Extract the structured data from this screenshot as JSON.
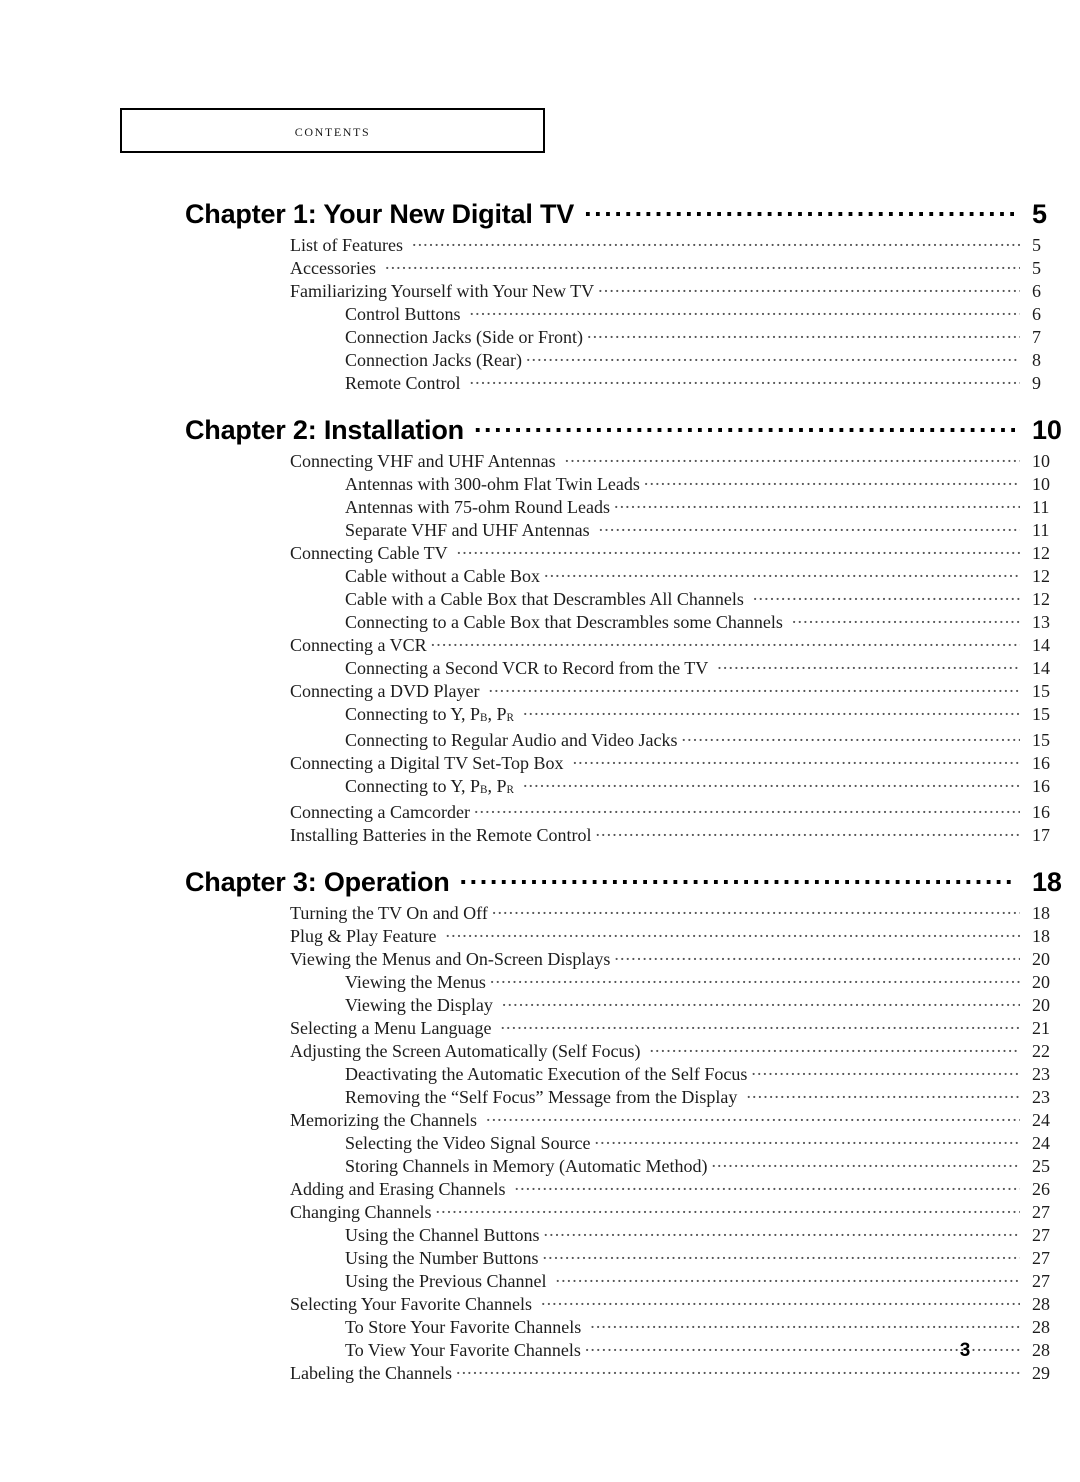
{
  "header": {
    "label": "Contents"
  },
  "folio": {
    "page_number": "3"
  },
  "toc": {
    "chapters": [
      {
        "title": "Chapter 1: Your New Digital TV",
        "page": "5",
        "entries": [
          {
            "level": 1,
            "text": "List of Features",
            "page": "5",
            "gap": true
          },
          {
            "level": 1,
            "text": "Accessories",
            "page": "5",
            "gap": true
          },
          {
            "level": 1,
            "text": "Familiarizing Yourself with Your New TV",
            "page": "6",
            "gap": false
          },
          {
            "level": 2,
            "text": "Control Buttons",
            "page": "6",
            "gap": true
          },
          {
            "level": 2,
            "text": "Connection Jacks (Side or Front)",
            "page": "7",
            "gap": false
          },
          {
            "level": 2,
            "text": "Connection Jacks (Rear)",
            "page": "8",
            "gap": false
          },
          {
            "level": 2,
            "text": "Remote Control",
            "page": "9",
            "gap": true
          }
        ]
      },
      {
        "title": "Chapter 2: Installation",
        "page": "10",
        "entries": [
          {
            "level": 1,
            "text": "Connecting VHF and UHF Antennas",
            "page": "10",
            "gap": true
          },
          {
            "level": 2,
            "text": "Antennas with 300-ohm Flat Twin Leads",
            "page": "10",
            "gap": false
          },
          {
            "level": 2,
            "text": "Antennas with 75-ohm Round Leads",
            "page": "11",
            "gap": false
          },
          {
            "level": 2,
            "text": "Separate VHF and UHF Antennas",
            "page": "11",
            "gap": true
          },
          {
            "level": 1,
            "text": "Connecting Cable TV",
            "page": "12",
            "gap": true
          },
          {
            "level": 2,
            "text": "Cable without a Cable Box",
            "page": "12",
            "gap": false
          },
          {
            "level": 2,
            "text": "Cable with a Cable Box that Descrambles All Channels",
            "page": "12",
            "gap": true
          },
          {
            "level": 2,
            "text": "Connecting to a Cable Box that Descrambles some Channels",
            "page": "13",
            "gap": true
          },
          {
            "level": 1,
            "text": "Connecting a VCR",
            "page": "14",
            "gap": false
          },
          {
            "level": 2,
            "text": "Connecting a Second VCR to Record from the TV",
            "page": "14",
            "gap": true
          },
          {
            "level": 1,
            "text": "Connecting a DVD Player",
            "page": "15",
            "gap": true
          },
          {
            "level": 2,
            "html": "Connecting to Y, P<sub class=\"sc\">B</sub>, P<sub class=\"sc\">R</sub>",
            "text": "Connecting to Y, PB, PR",
            "page": "15",
            "gap": true
          },
          {
            "level": 2,
            "text": "Connecting to Regular Audio and Video Jacks",
            "page": "15",
            "gap": false
          },
          {
            "level": 1,
            "text": "Connecting a Digital TV Set-Top Box",
            "page": "16",
            "gap": true
          },
          {
            "level": 2,
            "html": "Connecting to Y, P<sub class=\"sc\">B</sub>, P<sub class=\"sc\">R</sub>",
            "text": "Connecting to Y, PB, PR",
            "page": "16",
            "gap": true
          },
          {
            "level": 1,
            "text": "Connecting a Camcorder",
            "page": "16",
            "gap": false
          },
          {
            "level": 1,
            "text": "Installing Batteries in the Remote Control",
            "page": "17",
            "gap": false
          }
        ]
      },
      {
        "title": "Chapter 3: Operation",
        "page": "18",
        "entries": [
          {
            "level": 1,
            "text": "Turning the TV On and Off",
            "page": "18",
            "gap": false
          },
          {
            "level": 1,
            "text": "Plug & Play Feature",
            "page": "18",
            "gap": true
          },
          {
            "level": 1,
            "text": "Viewing the Menus and On-Screen Displays",
            "page": "20",
            "gap": false
          },
          {
            "level": 2,
            "text": "Viewing the Menus",
            "page": "20",
            "gap": false
          },
          {
            "level": 2,
            "text": "Viewing the Display",
            "page": "20",
            "gap": true
          },
          {
            "level": 1,
            "text": "Selecting a Menu Language",
            "page": "21",
            "gap": true
          },
          {
            "level": 1,
            "text": "Adjusting the Screen Automatically (Self Focus)",
            "page": "22",
            "gap": true
          },
          {
            "level": 2,
            "text": "Deactivating the Automatic Execution of the Self Focus",
            "page": "23",
            "gap": false
          },
          {
            "level": 2,
            "text": "Removing the “Self Focus” Message from the Display",
            "page": "23",
            "gap": true
          },
          {
            "level": 1,
            "text": "Memorizing the Channels",
            "page": "24",
            "gap": true
          },
          {
            "level": 2,
            "text": "Selecting the Video Signal Source",
            "page": "24",
            "gap": false
          },
          {
            "level": 2,
            "text": "Storing Channels in Memory (Automatic Method)",
            "page": "25",
            "gap": false
          },
          {
            "level": 1,
            "text": "Adding and Erasing Channels",
            "page": "26",
            "gap": true
          },
          {
            "level": 1,
            "text": "Changing Channels",
            "page": "27",
            "gap": false
          },
          {
            "level": 2,
            "text": "Using the Channel Buttons",
            "page": "27",
            "gap": false
          },
          {
            "level": 2,
            "text": "Using the Number Buttons",
            "page": "27",
            "gap": false
          },
          {
            "level": 2,
            "text": "Using the Previous Channel",
            "page": "27",
            "gap": true
          },
          {
            "level": 1,
            "text": "Selecting Your Favorite Channels",
            "page": "28",
            "gap": true
          },
          {
            "level": 2,
            "text": "To Store Your Favorite Channels",
            "page": "28",
            "gap": true
          },
          {
            "level": 2,
            "text": "To View Your Favorite Channels",
            "page": "28",
            "gap": false
          },
          {
            "level": 1,
            "text": "Labeling the Channels",
            "page": "29",
            "gap": false
          }
        ]
      }
    ]
  }
}
